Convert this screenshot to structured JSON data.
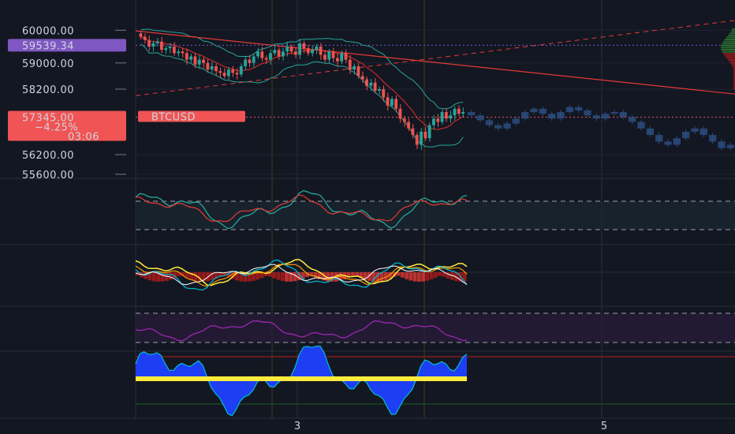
{
  "chart_data": {
    "type": "line",
    "symbol": "BTCUSD",
    "y_tick_labels": [
      "60000.00",
      "59000.00",
      "58200.00",
      "56200.00",
      "55600.00"
    ],
    "y_ticks": [
      60000,
      59000,
      58200,
      56200,
      55600
    ],
    "ylim": [
      55500,
      60200
    ],
    "last_price_label": "57345.00",
    "change_label": "−4.25%",
    "countdown_label": "03:06",
    "reference_price_label": "59539.34",
    "x_tick_labels": [
      "3",
      "5"
    ],
    "candles_close": [
      59800,
      59700,
      59500,
      59600,
      59650,
      59400,
      59450,
      59500,
      59300,
      59350,
      59300,
      59100,
      59200,
      58950,
      59100,
      59000,
      58800,
      58900,
      58750,
      58700,
      58600,
      58800,
      58700,
      58650,
      58900,
      59100,
      59000,
      59200,
      59350,
      59150,
      59100,
      59300,
      59400,
      59200,
      59350,
      59500,
      59350,
      59250,
      59600,
      59450,
      59300,
      59400,
      59500,
      59250,
      59100,
      59350,
      59150,
      59050,
      59300,
      59100,
      58800,
      58900,
      58600,
      58500,
      58300,
      58400,
      58150,
      58200,
      57950,
      57700,
      57900,
      57600,
      57300,
      57200,
      57000,
      56800,
      56500,
      56900,
      56700,
      57100,
      57300,
      57200,
      57500,
      57300,
      57400,
      57600,
      57450,
      57500
    ],
    "forecast_close": [
      57400,
      57250,
      57100,
      57000,
      57150,
      57300,
      57500,
      57600,
      57450,
      57300,
      57500,
      57650,
      57550,
      57400,
      57300,
      57450,
      57500,
      57350,
      57200,
      57000,
      56800,
      56600,
      56500,
      56700,
      56900,
      57000,
      56800,
      56600,
      56400,
      56500
    ],
    "indicators": {
      "oscillator_1": {
        "series_colors": [
          "#26a69a",
          "#e53935"
        ]
      },
      "oscillator_2": {
        "series_colors": [
          "#ffeb3b",
          "#ff9800",
          "#00bcd4",
          "#ffffff"
        ]
      },
      "oscillator_3": {
        "series_colors": [
          "#9c27b0"
        ]
      },
      "oscillator_4": {
        "series_colors": [
          "#1e40ff",
          "#ffeb3b",
          "#00bcd4"
        ]
      }
    },
    "colors": {
      "background": "#131722",
      "candle_up": "#26a69a",
      "candle_down": "#ef5350",
      "forecast": "#2a4a7a",
      "price_label_bg": "#f05454",
      "reference_label_bg": "#7e57c2",
      "trendline": "#e53935"
    }
  }
}
